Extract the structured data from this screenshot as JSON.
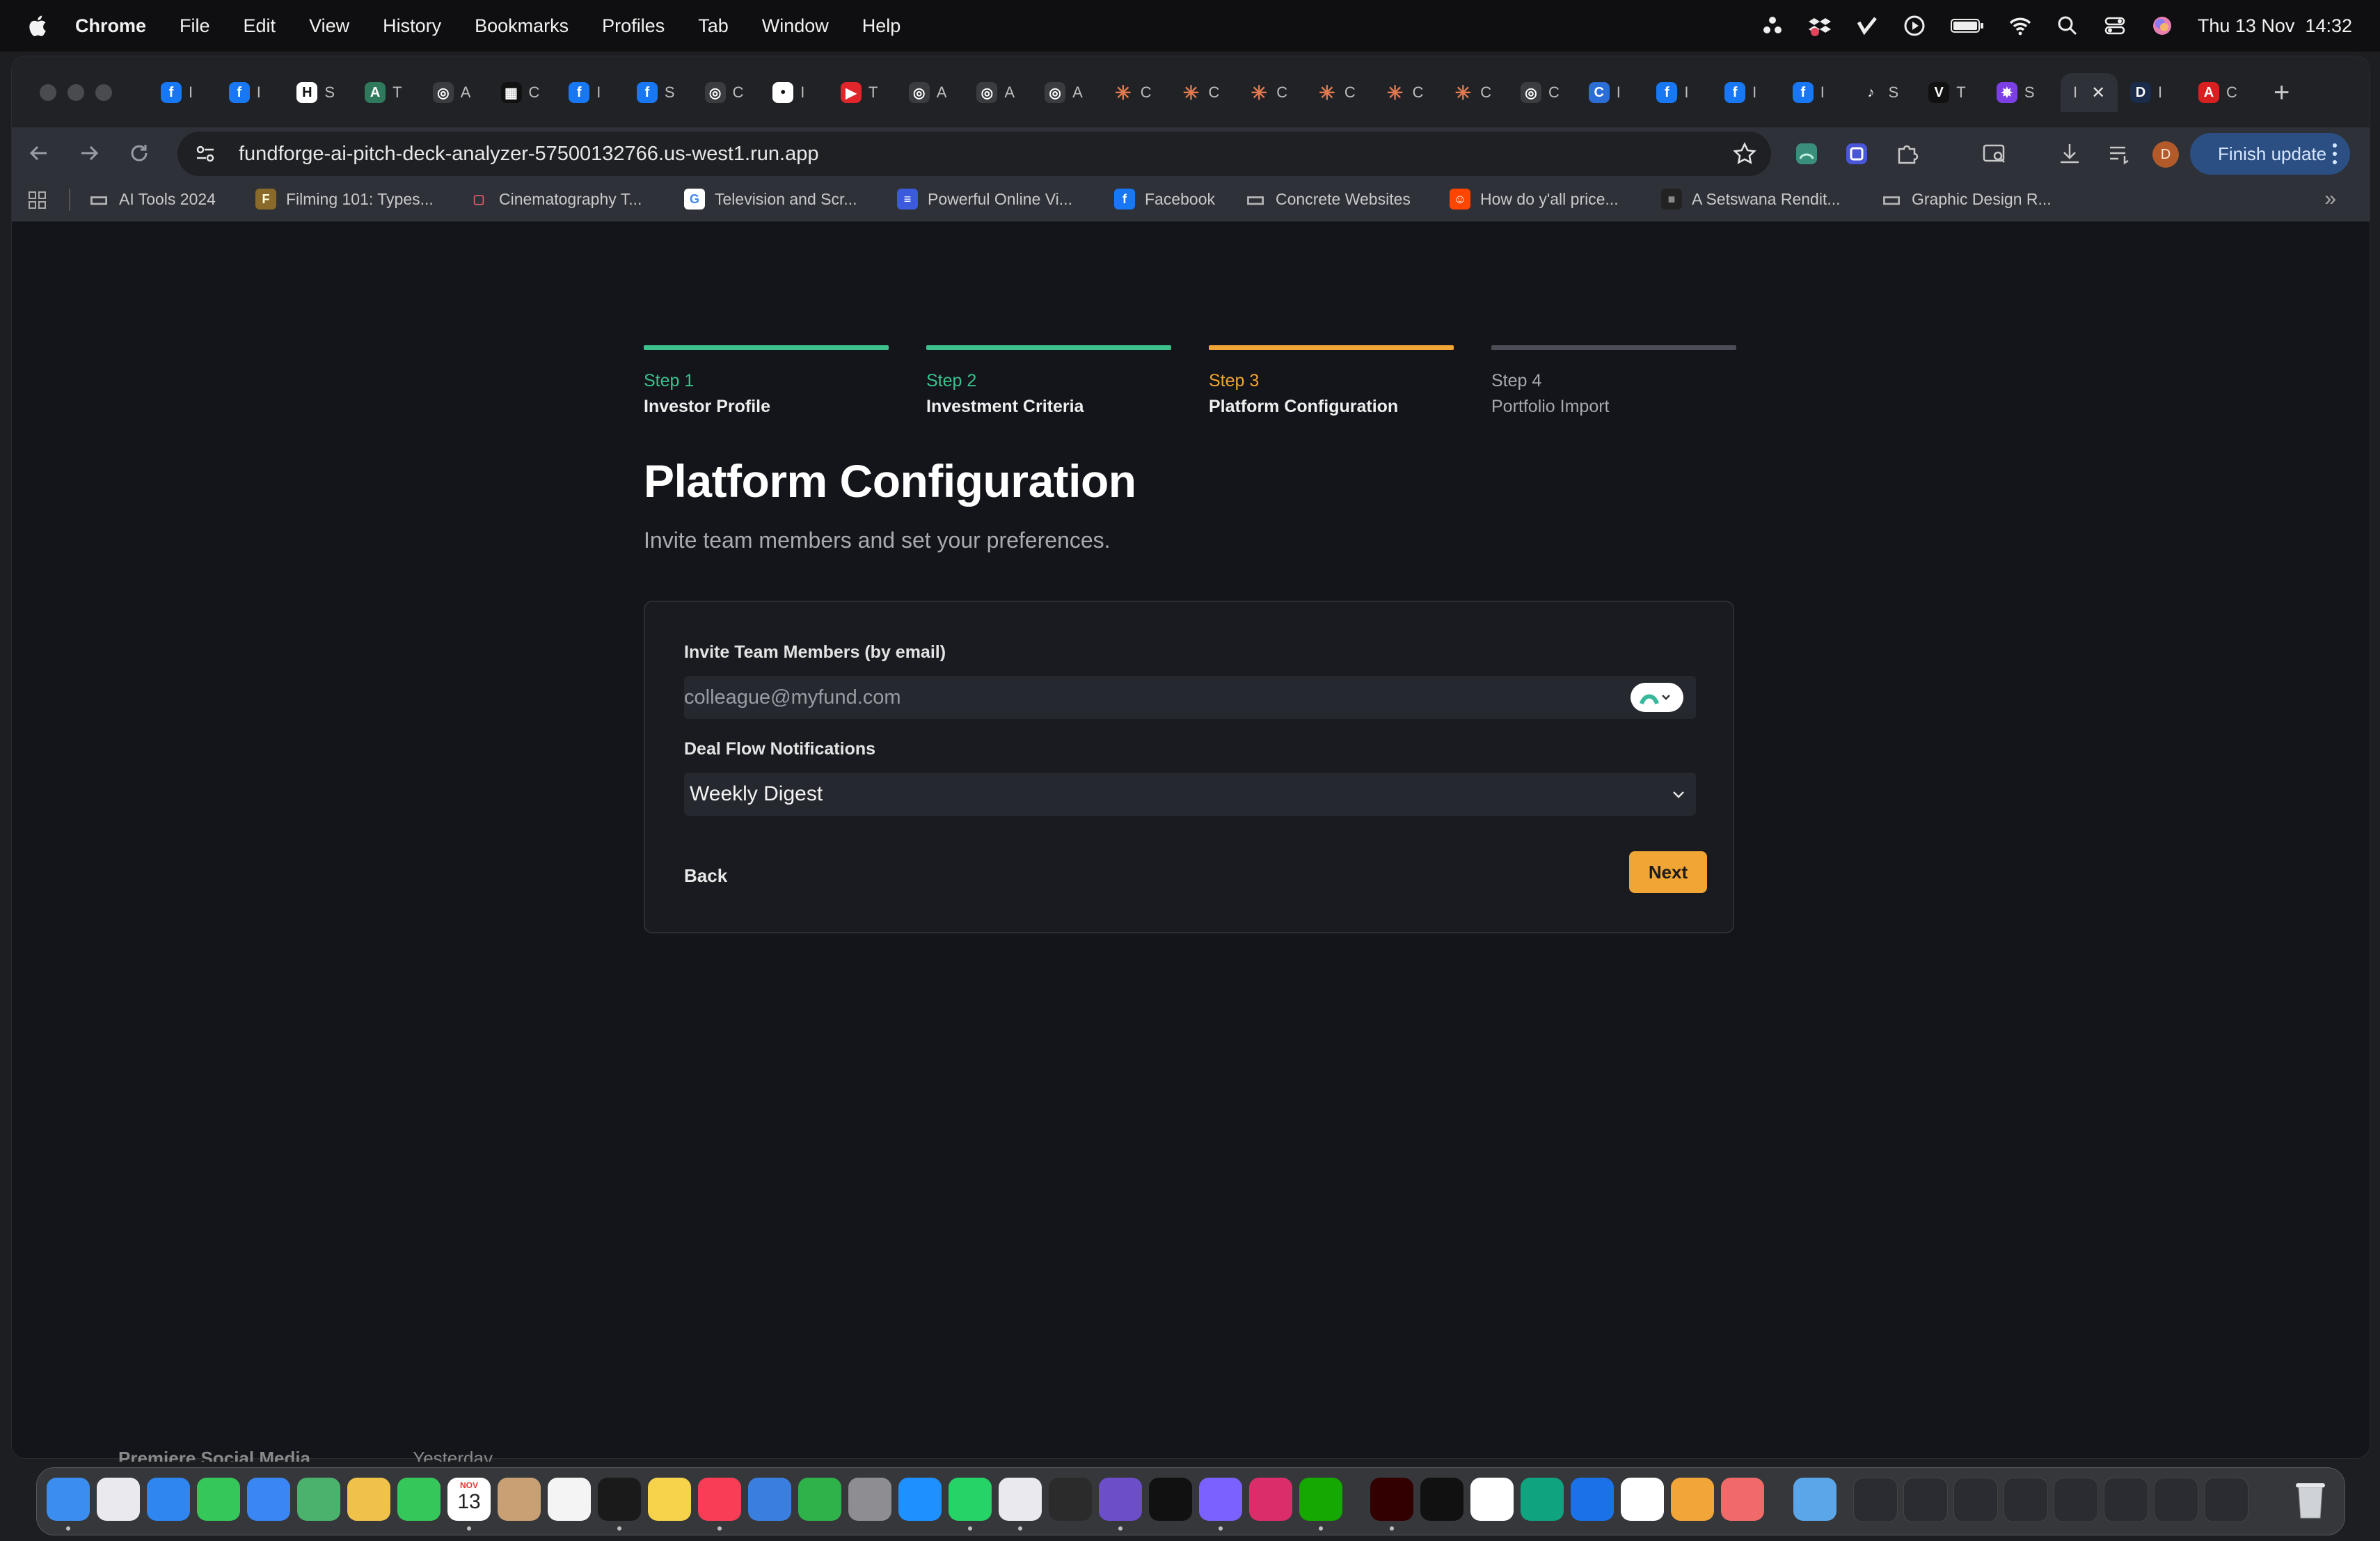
{
  "menubar": {
    "items": [
      "Chrome",
      "File",
      "Edit",
      "View",
      "History",
      "Bookmarks",
      "Profiles",
      "Tab",
      "Window",
      "Help"
    ],
    "datetime": "Thu 13 Nov  14:32"
  },
  "browser": {
    "tabs": [
      {
        "icon": "facebook-icon",
        "text": "I"
      },
      {
        "icon": "facebook-icon",
        "text": "I"
      },
      {
        "icon": "h-logo-icon",
        "text": "S"
      },
      {
        "icon": "a-logo-icon",
        "text": "T"
      },
      {
        "icon": "openai-icon",
        "text": "A"
      },
      {
        "icon": "grid-logo-icon",
        "text": "C"
      },
      {
        "icon": "facebook-icon",
        "text": "I"
      },
      {
        "icon": "facebook-icon",
        "text": "S"
      },
      {
        "icon": "openai-icon",
        "text": "C"
      },
      {
        "icon": "chat-icon",
        "text": "I"
      },
      {
        "icon": "youtube-icon",
        "text": "T"
      },
      {
        "icon": "openai-icon",
        "text": "A"
      },
      {
        "icon": "openai-icon",
        "text": "A"
      },
      {
        "icon": "openai-icon",
        "text": "A"
      },
      {
        "icon": "claude-icon",
        "text": "C"
      },
      {
        "icon": "claude-icon",
        "text": "C"
      },
      {
        "icon": "claude-icon",
        "text": "C"
      },
      {
        "icon": "claude-icon",
        "text": "C"
      },
      {
        "icon": "claude-icon",
        "text": "C"
      },
      {
        "icon": "claude-icon",
        "text": "C"
      },
      {
        "icon": "openai-icon",
        "text": "C"
      },
      {
        "icon": "c-logo-icon",
        "text": "I"
      },
      {
        "icon": "facebook-icon",
        "text": "I"
      },
      {
        "icon": "facebook-icon",
        "text": "I"
      },
      {
        "icon": "facebook-icon",
        "text": "I"
      },
      {
        "icon": "speaker-icon",
        "text": "S"
      },
      {
        "icon": "v-logo-icon",
        "text": "T"
      },
      {
        "icon": "purple-logo-icon",
        "text": "S"
      }
    ],
    "active_tab": {
      "text": "I"
    },
    "after_tabs": [
      {
        "icon": "d-logo-icon",
        "text": "D",
        "sub": "I"
      },
      {
        "icon": "red-logo-icon",
        "text": "C"
      }
    ],
    "url": "fundforge-ai-pitch-deck-analyzer-57500132766.us-west1.run.app",
    "avatar_letter": "D",
    "finish_update": "Finish update",
    "bookmarks": [
      {
        "icon": "folder-icon",
        "label": "AI Tools 2024"
      },
      {
        "icon": "filming-icon",
        "label": "Filming 101: Types..."
      },
      {
        "icon": "chat-bubble-icon",
        "label": "Cinematography T..."
      },
      {
        "icon": "google-icon",
        "label": "Television and Scr..."
      },
      {
        "icon": "doc-icon",
        "label": "Powerful Online Vi..."
      },
      {
        "icon": "facebook-icon",
        "label": "Facebook"
      },
      {
        "icon": "folder-icon",
        "label": "Concrete Websites"
      },
      {
        "icon": "reddit-icon",
        "label": "How do y'all price..."
      },
      {
        "icon": "image-icon",
        "label": "A Setswana Rendit..."
      },
      {
        "icon": "folder-icon",
        "label": "Graphic Design R..."
      }
    ]
  },
  "steps": [
    {
      "label": "Step 1",
      "title": "Investor Profile",
      "status": "complete"
    },
    {
      "label": "Step 2",
      "title": "Investment Criteria",
      "status": "complete"
    },
    {
      "label": "Step 3",
      "title": "Platform Configuration",
      "status": "current"
    },
    {
      "label": "Step 4",
      "title": "Portfolio Import",
      "status": "upcoming"
    }
  ],
  "colors": {
    "complete": "#3cc18c",
    "current": "#f0a534",
    "upcoming": "#4a4d55",
    "accent_button": "#f0a534"
  },
  "page": {
    "heading": "Platform Configuration",
    "subheading": "Invite team members and set your preferences."
  },
  "form": {
    "invite_label": "Invite Team Members (by email)",
    "invite_placeholder": "colleague@myfund.com",
    "invite_value": "",
    "notifications_label": "Deal Flow Notifications",
    "notifications_value": "Weekly Digest",
    "back_label": "Back",
    "next_label": "Next"
  },
  "background_window": {
    "title": "Premiere Social Media",
    "date": "Yesterday"
  },
  "dock": {
    "apps": [
      "finder",
      "launchpad",
      "safari",
      "messages",
      "mail",
      "maps",
      "photos",
      "facetime",
      "calendar",
      "contacts",
      "reminders",
      "apple-tv",
      "notes",
      "music",
      "keynote",
      "numbers",
      "settings",
      "app-store",
      "whatsapp",
      "preview",
      "terminal",
      "github",
      "capcut",
      "ghost",
      "creative-cloud",
      "upwork",
      "illustrator",
      "capcut-2",
      "vpn",
      "chatgpt",
      "affinity",
      "chrome",
      "pages",
      "asana",
      "downloads",
      "trash"
    ],
    "calendar_month": "NOV",
    "calendar_day": "13"
  }
}
